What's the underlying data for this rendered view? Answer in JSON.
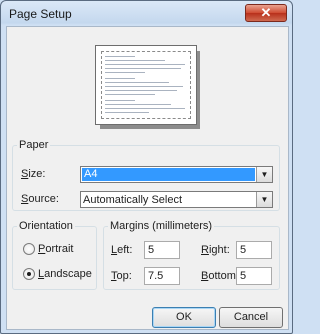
{
  "window": {
    "title": "Page Setup",
    "close_glyph": "✕"
  },
  "paper": {
    "legend": "Paper",
    "size_label_accel": "S",
    "size_label_rest": "ize:",
    "size_value": "A4",
    "source_label_accel": "S",
    "source_label_rest": "ource:",
    "source_value": "Automatically Select"
  },
  "orientation": {
    "legend": "Orientation",
    "portrait_accel": "P",
    "portrait_rest": "ortrait",
    "landscape_accel": "L",
    "landscape_rest": "andscape",
    "selected": "landscape"
  },
  "margins": {
    "legend": "Margins (millimeters)",
    "left_accel": "L",
    "left_rest": "eft:",
    "left_value": "5",
    "right_accel": "R",
    "right_rest": "ight:",
    "right_value": "5",
    "top_accel": "T",
    "top_rest": "op:",
    "top_value": "7.5",
    "bottom_accel": "B",
    "bottom_rest": "ottom:",
    "bottom_value": "5"
  },
  "buttons": {
    "ok": "OK",
    "cancel": "Cancel"
  },
  "icons": {
    "dropdown": "chevron-down-icon",
    "close": "close-icon"
  },
  "colors": {
    "selection": "#3399ff",
    "close_button": "#cf4a31"
  }
}
